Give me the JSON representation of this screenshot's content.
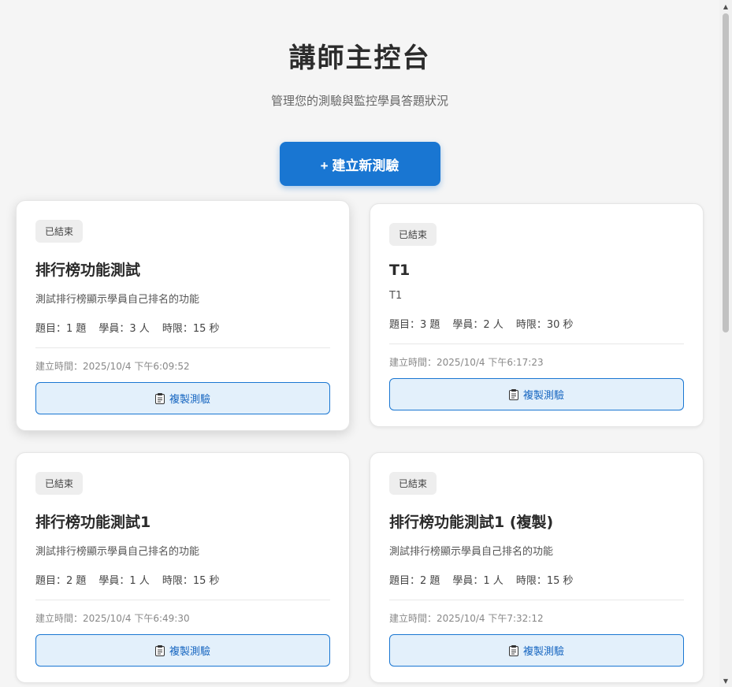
{
  "header": {
    "title": "講師主控台",
    "subtitle": "管理您的測驗與監控學員答題狀況",
    "create_button_label": "+ 建立新測驗"
  },
  "colors": {
    "primary": "#1976d2",
    "copy_button_bg": "#e3f0fb",
    "badge_bg": "#eeeeee",
    "page_bg": "#f5f5f5"
  },
  "cards": [
    {
      "status": "已結束",
      "title": "排行榜功能測試",
      "description": "測試排行榜顯示學員自己排名的功能",
      "questions": "題目：1 題",
      "students": "學員：3 人",
      "time_limit": "時限：15 秒",
      "created": "建立時間：2025/10/4 下午6:09:52",
      "copy_label": "複製測驗",
      "copy_icon": "clipboard-icon"
    },
    {
      "status": "已結束",
      "title": "T1",
      "description": "T1",
      "questions": "題目：3 題",
      "students": "學員：2 人",
      "time_limit": "時限：30 秒",
      "created": "建立時間：2025/10/4 下午6:17:23",
      "copy_label": "複製測驗",
      "copy_icon": "clipboard-icon"
    },
    {
      "status": "已結束",
      "title": "排行榜功能測試1",
      "description": "測試排行榜顯示學員自己排名的功能",
      "questions": "題目：2 題",
      "students": "學員：1 人",
      "time_limit": "時限：15 秒",
      "created": "建立時間：2025/10/4 下午6:49:30",
      "copy_label": "複製測驗",
      "copy_icon": "clipboard-icon"
    },
    {
      "status": "已結束",
      "title": "排行榜功能測試1 (複製)",
      "description": "測試排行榜顯示學員自己排名的功能",
      "questions": "題目：2 題",
      "students": "學員：1 人",
      "time_limit": "時限：15 秒",
      "created": "建立時間：2025/10/4 下午7:32:12",
      "copy_label": "複製測驗",
      "copy_icon": "clipboard-icon"
    }
  ]
}
